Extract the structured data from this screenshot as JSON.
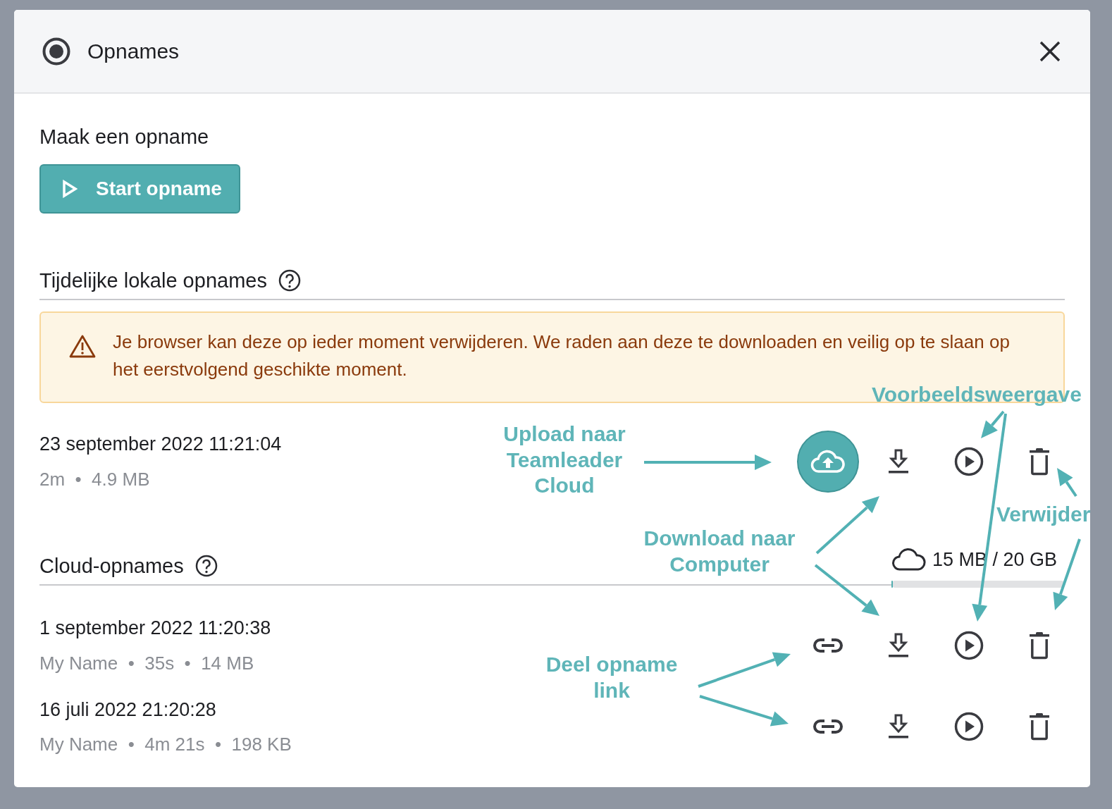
{
  "dialog": {
    "title": "Opnames"
  },
  "create": {
    "heading": "Maak een opname",
    "button": "Start opname"
  },
  "local": {
    "heading": "Tijdelijke lokale opnames",
    "alert": "Je browser kan deze op ieder moment verwijderen. We raden aan deze te downloaden en veilig op te slaan op het eerstvolgend geschikte moment.",
    "recordings": [
      {
        "date": "23 september 2022 11:21:04",
        "meta": "2m  •  4.9 MB",
        "actions": [
          {
            "kind": "upload"
          },
          {
            "kind": "download"
          },
          {
            "kind": "play"
          },
          {
            "kind": "delete"
          }
        ]
      }
    ]
  },
  "cloud": {
    "heading": "Cloud-opnames",
    "storage": {
      "reading": "15 MB / 20 GB",
      "level": 0.01
    },
    "recordings": [
      {
        "date": "1 september 2022 11:20:38",
        "meta": "My Name  •  35s  •  14 MB",
        "actions": [
          {
            "kind": "link"
          },
          {
            "kind": "download"
          },
          {
            "kind": "play"
          },
          {
            "kind": "delete"
          }
        ]
      },
      {
        "date": "16 juli 2022 21:20:28",
        "meta": "My Name  •  4m 21s  •  198 KB",
        "actions": [
          {
            "kind": "link"
          },
          {
            "kind": "download"
          },
          {
            "kind": "play"
          },
          {
            "kind": "delete"
          }
        ]
      }
    ]
  },
  "annotations": [
    {
      "text": "Upload naar Teamleader Cloud"
    },
    {
      "text": "Voorbeeldsweergave"
    },
    {
      "text": "Download naar Computer"
    },
    {
      "text": "Verwijder"
    },
    {
      "text": "Deel opname link"
    }
  ]
}
